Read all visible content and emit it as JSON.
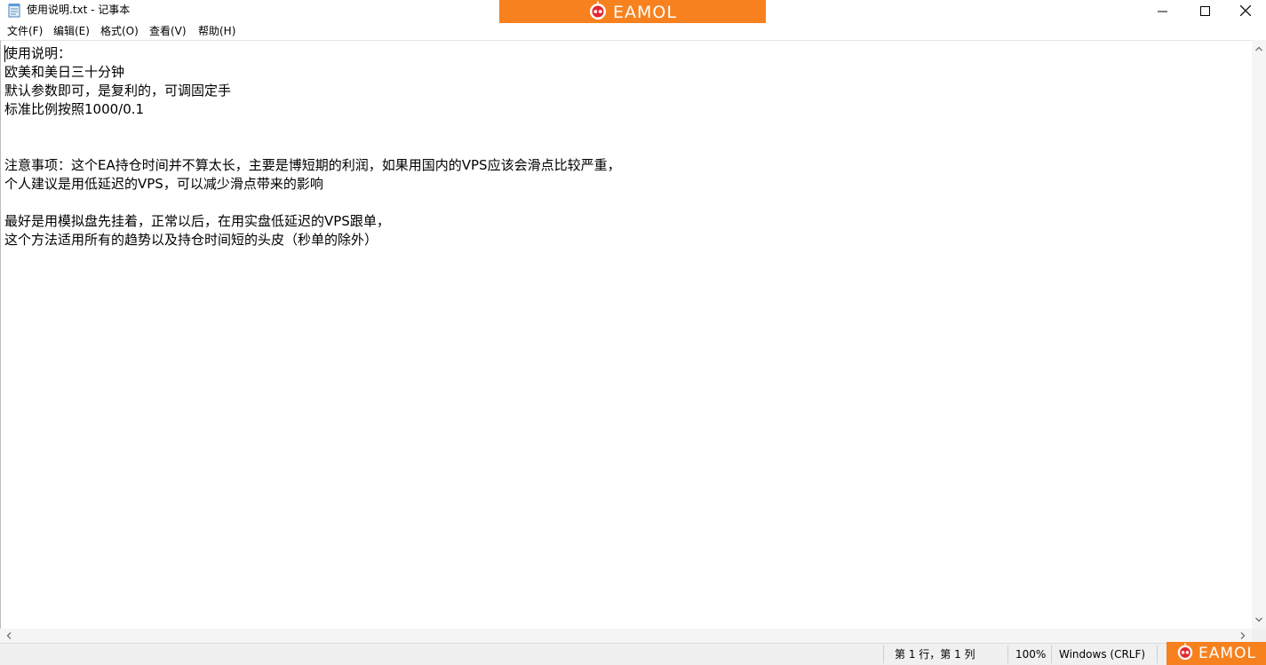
{
  "window": {
    "title": "使用说明.txt - 记事本"
  },
  "banner": {
    "logo_text": "EAMOL",
    "color": "#f7811e"
  },
  "menu": {
    "items": [
      {
        "label": "文件(F)"
      },
      {
        "label": "编辑(E)"
      },
      {
        "label": "格式(O)"
      },
      {
        "label": "查看(V)"
      },
      {
        "label": "帮助(H)"
      }
    ]
  },
  "document": {
    "lines": [
      "使用说明：",
      "欧美和美日三十分钟",
      "默认参数即可，是复利的，可调固定手",
      "标准比例按照1000/0.1",
      "",
      "",
      "注意事项：这个EA持仓时间并不算太长，主要是博短期的利润，如果用国内的VPS应该会滑点比较严重，",
      "个人建议是用低延迟的VPS，可以减少滑点带来的影响",
      "",
      "最好是用模拟盘先挂着，正常以后，在用实盘低延迟的VPS跟单，",
      "这个方法适用所有的趋势以及持仓时间短的头皮（秒单的除外）"
    ]
  },
  "status": {
    "position": "第 1 行，第 1 列",
    "zoom": "100%",
    "line_ending": "Windows (CRLF)"
  },
  "badge": {
    "logo_text": "EAMOL"
  },
  "icons": {
    "app": "notepad-icon",
    "minimize": "minimize-icon",
    "maximize": "maximize-icon",
    "close": "close-icon",
    "logo": "robot-logo-icon"
  }
}
